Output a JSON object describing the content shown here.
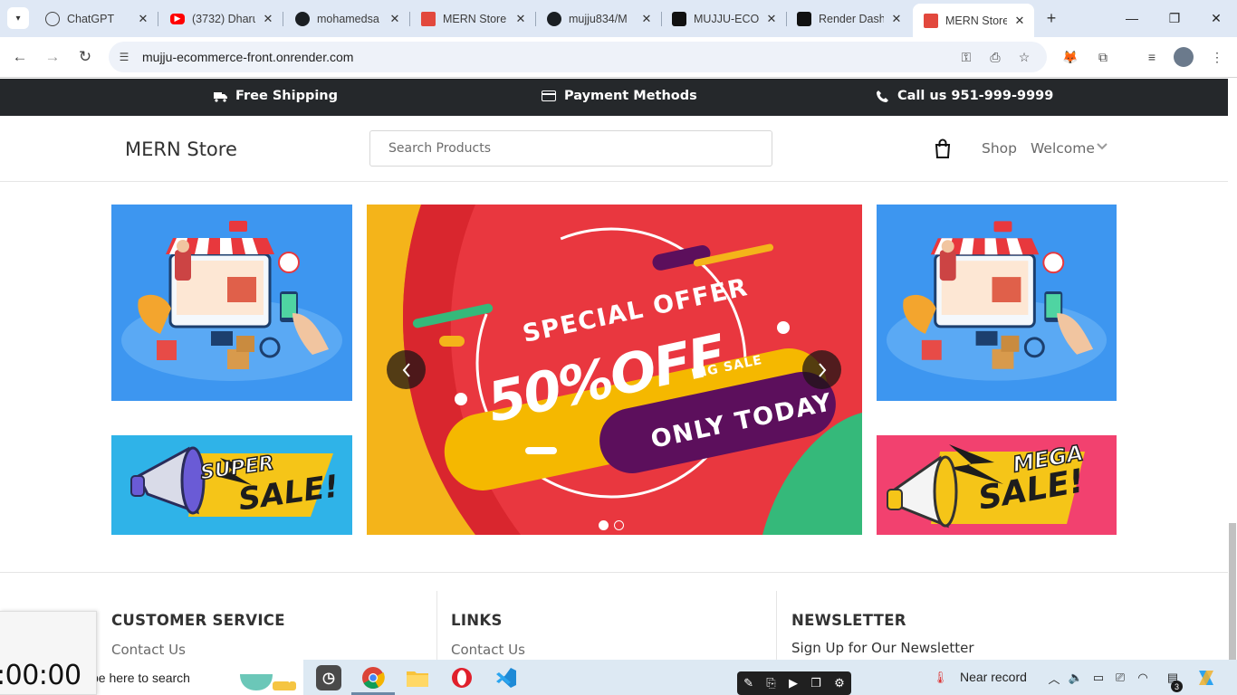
{
  "browser": {
    "tabs": [
      {
        "title": "ChatGPT",
        "icon": "chatgpt-icon"
      },
      {
        "title": "(3732) Dharu",
        "icon": "youtube-icon"
      },
      {
        "title": "mohamedsa",
        "icon": "github-icon"
      },
      {
        "title": "MERN Store",
        "icon": "store-icon"
      },
      {
        "title": "mujju834/M",
        "icon": "github-icon"
      },
      {
        "title": "MUJJU-ECON",
        "icon": "render-icon"
      },
      {
        "title": "Render Dash",
        "icon": "render-icon"
      },
      {
        "title": "MERN Store",
        "icon": "store-icon",
        "active": true
      }
    ],
    "url": "mujju-ecommerce-front.onrender.com"
  },
  "topbar": {
    "shipping": "Free Shipping",
    "payment": "Payment Methods",
    "call": "Call us 951-999-9999"
  },
  "header": {
    "logo": "MERN Store",
    "search_placeholder": "Search Products",
    "shop": "Shop",
    "welcome": "Welcome"
  },
  "banners": {
    "left_bottom_line1": "SUPER",
    "left_bottom_line2": "SALE!",
    "right_bottom_line1": "MEGA",
    "right_bottom_line2": "SALE!",
    "carousel": {
      "line1": "SPECIAL OFFER",
      "line2": "50%OFF",
      "line3": "BIG SALE",
      "line4": "ONLY TODAY",
      "slides": 2,
      "active_slide": 1
    }
  },
  "footer": {
    "col1": {
      "heading": "CUSTOMER SERVICE",
      "link": "Contact Us"
    },
    "col2": {
      "heading": "LINKS",
      "link": "Contact Us"
    },
    "col3": {
      "heading": "NEWSLETTER",
      "text": "Sign Up for Our Newsletter"
    }
  },
  "overlay_timer": ":00:00",
  "taskbar": {
    "search": "pe here to search",
    "weather": "Near record",
    "notifications": "3"
  },
  "colors": {
    "topbar": "#25282b",
    "banner_blue": "#3d96f0",
    "carousel_red": "#e9373f",
    "offer_yellow": "#f5b800",
    "pill_purple": "#5c0f5c",
    "mega_pink": "#f2416f"
  }
}
